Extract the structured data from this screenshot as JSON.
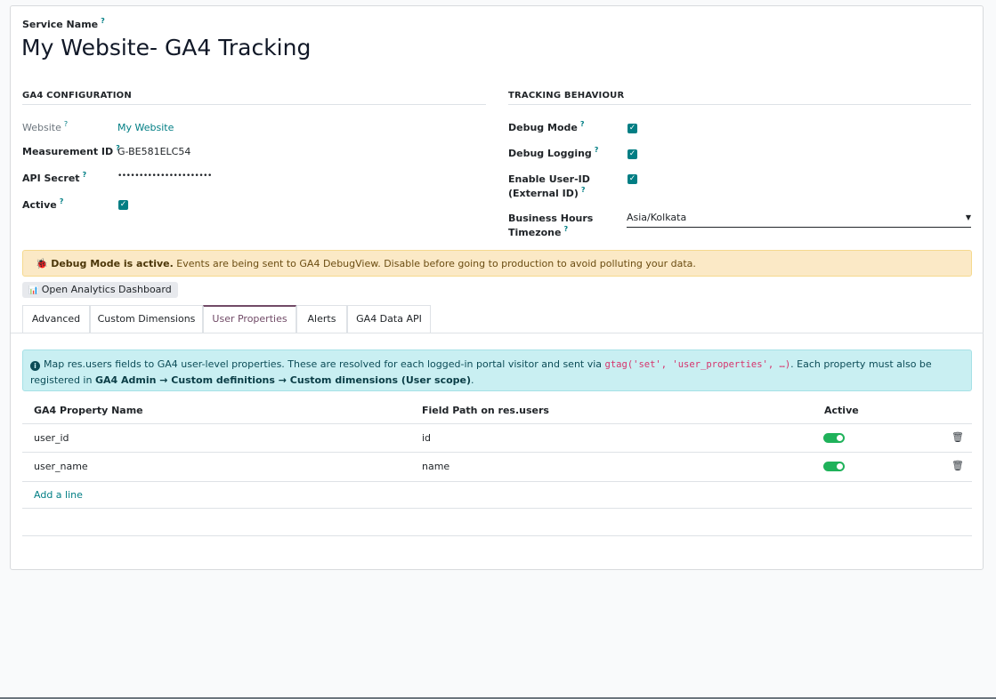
{
  "header": {
    "service_name_label": "Service Name",
    "help": "?",
    "title": "My Website- GA4 Tracking"
  },
  "ga4_config": {
    "section_title": "GA4 CONFIGURATION",
    "website_label": "Website",
    "website_value": "My Website",
    "measurement_label": "Measurement ID",
    "measurement_value": "G-BE581ELC54",
    "api_secret_label": "API Secret",
    "api_secret_value": "••••••••••••••••••••••",
    "active_label": "Active",
    "active_checked": true
  },
  "tracking": {
    "section_title": "TRACKING BEHAVIOUR",
    "debug_mode_label": "Debug Mode",
    "debug_mode_checked": true,
    "debug_logging_label": "Debug Logging",
    "debug_logging_checked": true,
    "user_id_label_line1": "Enable User-ID",
    "user_id_label_line2": "(External ID)",
    "user_id_checked": true,
    "tz_label_line1": "Business Hours",
    "tz_label_line2": "Timezone",
    "tz_value": "Asia/Kolkata"
  },
  "warning": {
    "bold": "Debug Mode is active.",
    "text": " Events are being sent to GA4 DebugView. Disable before going to production to avoid polluting your data."
  },
  "dashboard_button": "Open Analytics Dashboard",
  "tabs": [
    {
      "label": "Advanced"
    },
    {
      "label": "Custom Dimensions"
    },
    {
      "label": "User Properties",
      "active": true
    },
    {
      "label": "Alerts"
    },
    {
      "label": "GA4 Data API"
    }
  ],
  "info": {
    "text1": "Map res.users fields to GA4 user-level properties. These are resolved for each logged-in portal visitor and sent via ",
    "code": "gtag('set', 'user_properties', …)",
    "text2": ". Each property must also be registered in ",
    "bold": "GA4 Admin → Custom definitions → Custom dimensions (User scope)",
    "text3": "."
  },
  "table": {
    "columns": [
      "GA4 Property Name",
      "Field Path on res.users",
      "Active"
    ],
    "rows": [
      {
        "property": "user_id",
        "field": "id",
        "active": true
      },
      {
        "property": "user_name",
        "field": "name",
        "active": true
      }
    ],
    "add_line": "Add a line"
  },
  "colors": {
    "accent": "#017e84",
    "tab_active": "#714b67",
    "toggle_on": "#1fb25a",
    "warning_bg": "#fbe9c6",
    "info_bg": "#c9eff2"
  }
}
